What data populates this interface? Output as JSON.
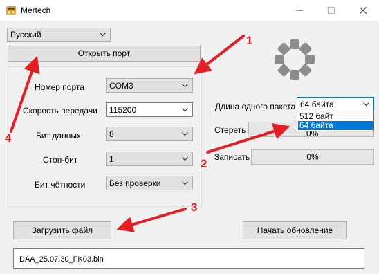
{
  "window": {
    "title": "Mertech",
    "min": "—",
    "max": "☐",
    "close": "✕"
  },
  "language": {
    "value": "Русский"
  },
  "open_port_button": "Открыть порт",
  "port_settings": {
    "port_number": {
      "label": "Номер порта",
      "value": "COM3"
    },
    "baud_rate": {
      "label": "Скорость передачи",
      "value": "115200"
    },
    "data_bits": {
      "label": "Бит данных",
      "value": "8"
    },
    "stop_bits": {
      "label": "Стоп-бит",
      "value": "1"
    },
    "parity": {
      "label": "Бит чётности",
      "value": "Без проверки"
    }
  },
  "packet": {
    "label": "Длина одного пакета",
    "value": "64 байта",
    "options": [
      "512 байт",
      "64 байта"
    ],
    "selected_option": "64 байта"
  },
  "erase": {
    "label": "Стереть",
    "progress_text": "0%",
    "progress": 0
  },
  "write": {
    "label": "Записать",
    "progress_text": "0%",
    "progress": 0
  },
  "load_file_button": "Загрузить файл",
  "start_update_button": "Начать обновление",
  "file_path": "DAA_25.07.30_FK03.bin",
  "annotations": {
    "n1": "1",
    "n2": "2",
    "n3": "3",
    "n4": "4",
    "color": "#e31e24"
  },
  "icons": [
    "app-icon",
    "minimize-icon",
    "maximize-icon",
    "close-icon",
    "chevron-down-icon",
    "spinner-icon"
  ]
}
